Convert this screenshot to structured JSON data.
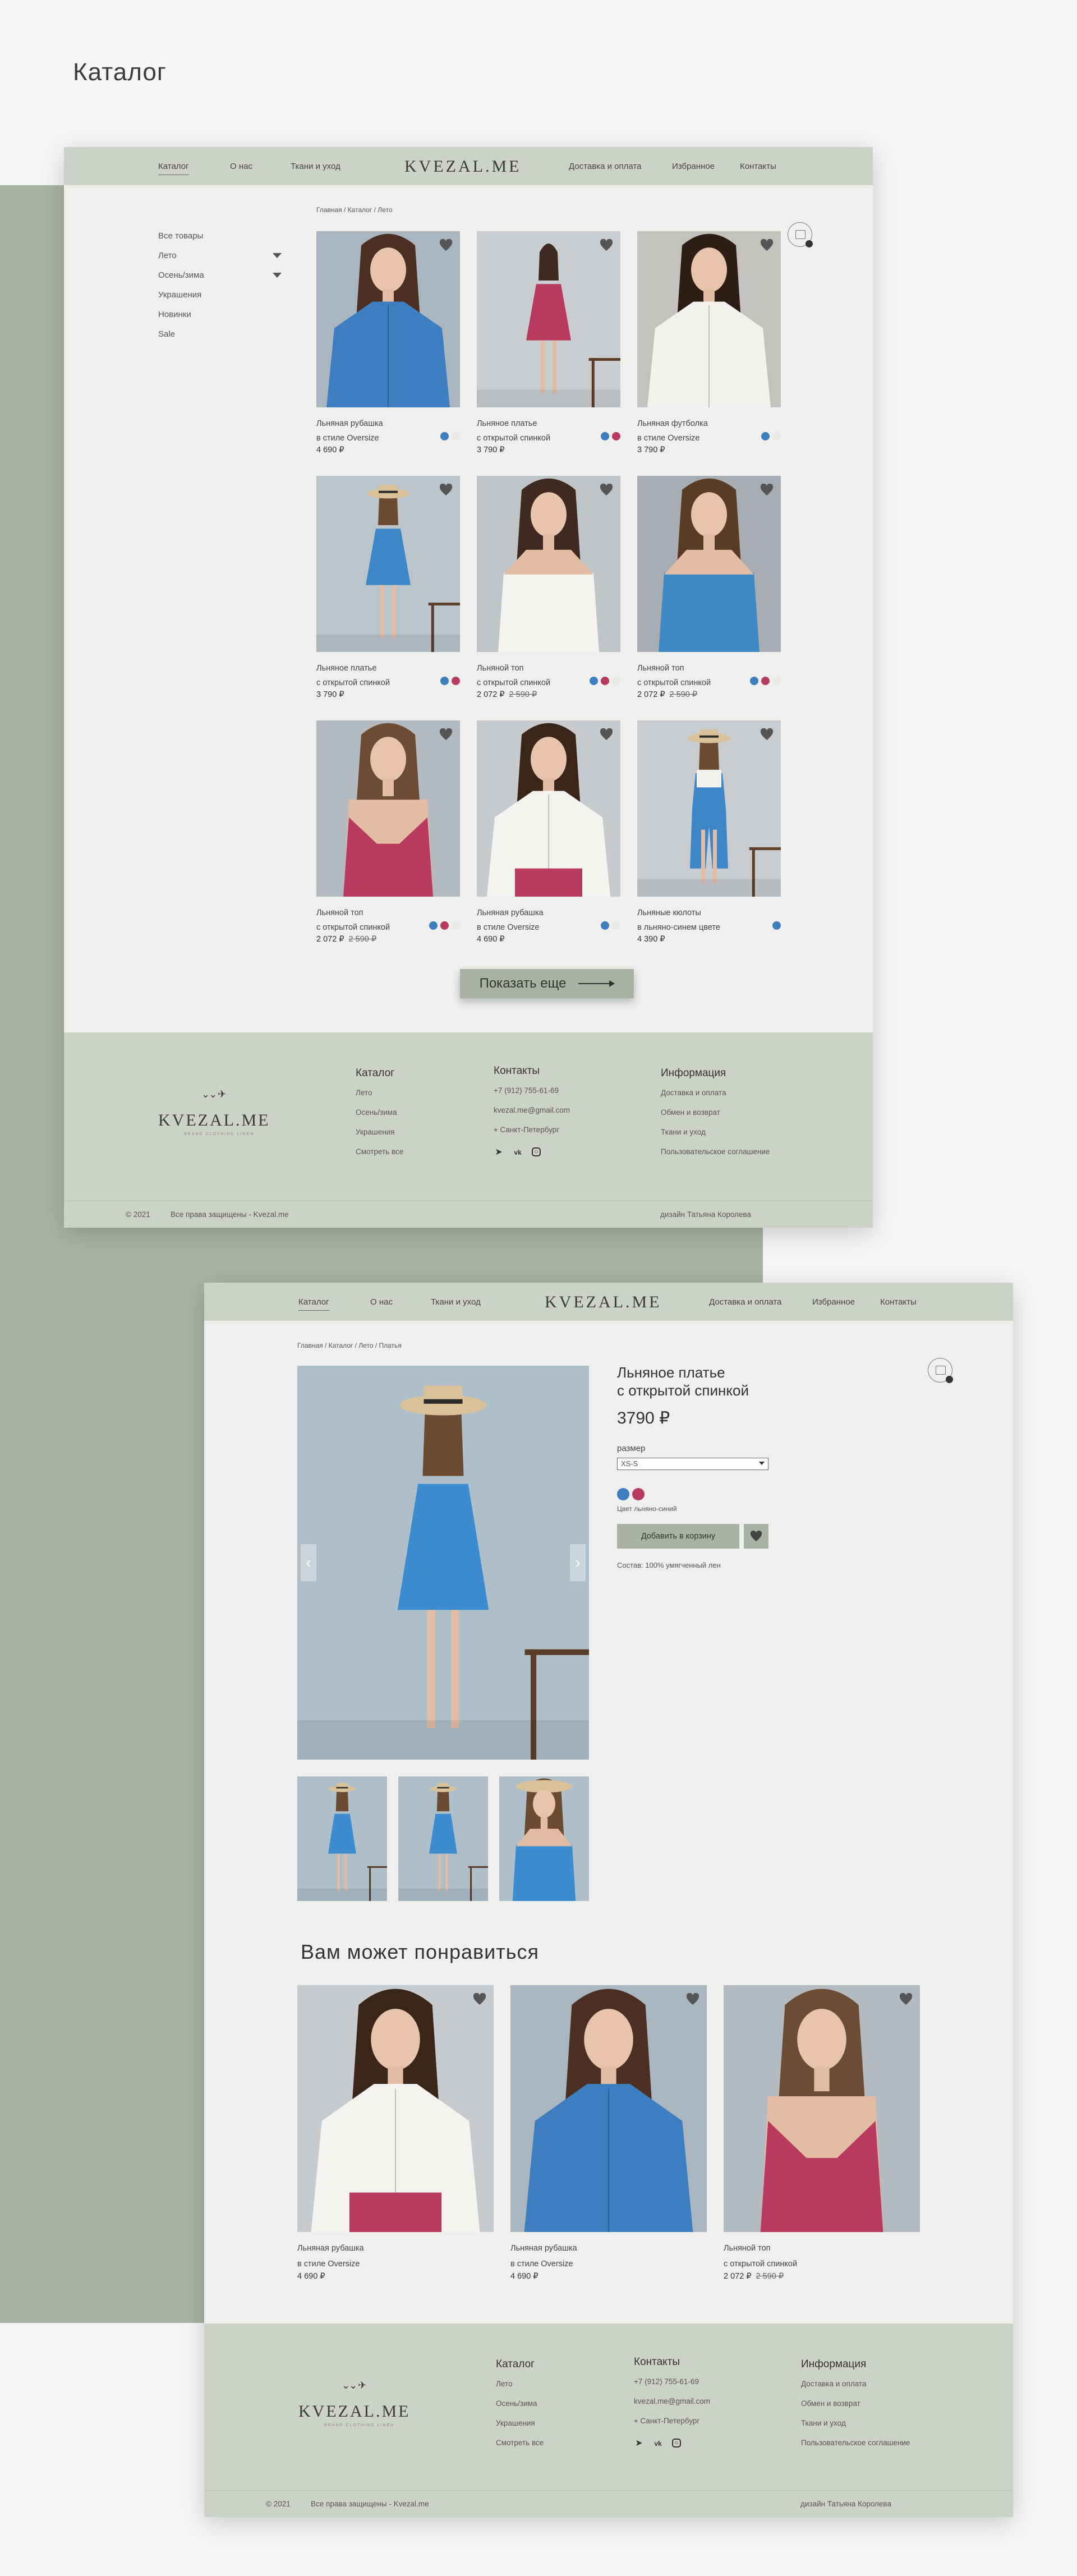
{
  "page_title": "Каталог",
  "brand": {
    "logo": "KVEZAL.ME",
    "tagline": "BRAND CLOTHING LINEN"
  },
  "nav": {
    "left": [
      "Каталог",
      "О нас",
      "Ткани и уход"
    ],
    "right": [
      "Доставка и оплата",
      "Избранное",
      "Контакты"
    ]
  },
  "colors": {
    "accent": "#aab3a3",
    "nav_bg": "#cdd2c9",
    "blue": "#3d7ec0",
    "raspberry": "#b83a5e",
    "white": "#e8e8e4"
  },
  "catalog": {
    "breadcrumb": "Главная / Каталог / Лето",
    "sidebar": [
      {
        "label": "Все товары",
        "chevron": false
      },
      {
        "label": "Лето",
        "chevron": true
      },
      {
        "label": "Осень/зима",
        "chevron": true
      },
      {
        "label": "Украшения",
        "chevron": false
      },
      {
        "label": "Новинки",
        "chevron": false
      },
      {
        "label": "Sale",
        "chevron": false
      }
    ],
    "products": [
      {
        "line1": "Льняная рубашка",
        "line2": "в стиле Oversize",
        "price": "4 690 ₽",
        "old_price": "",
        "swatches": [
          "#3d7ec0",
          "#e8e8e4"
        ],
        "photo": "blue-shirt"
      },
      {
        "line1": "Льняное платье",
        "line2": "с открытой спинкой",
        "price": "3 790 ₽",
        "old_price": "",
        "swatches": [
          "#3d7ec0",
          "#b83a5e"
        ],
        "photo": "pink-dress"
      },
      {
        "line1": "Льняная футболка",
        "line2": "в стиле Oversize",
        "price": "3 790 ₽",
        "old_price": "",
        "swatches": [
          "#3d7ec0",
          "#e8e8e4"
        ],
        "photo": "white-tee"
      },
      {
        "line1": "Льняное платье",
        "line2": "с открытой спинкой",
        "price": "3 790 ₽",
        "old_price": "",
        "swatches": [
          "#3d7ec0",
          "#b83a5e"
        ],
        "photo": "blue-dress"
      },
      {
        "line1": "Льняной топ",
        "line2": "с открытой спинкой",
        "price": "2 072 ₽",
        "old_price": "2 590 ₽",
        "swatches": [
          "#3d7ec0",
          "#b83a5e",
          "#e8e8e4"
        ],
        "photo": "white-top"
      },
      {
        "line1": "Льняной топ",
        "line2": "с открытой спинкой",
        "price": "2 072 ₽",
        "old_price": "2 590 ₽",
        "swatches": [
          "#3d7ec0",
          "#b83a5e",
          "#e8e8e4"
        ],
        "photo": "blue-top"
      },
      {
        "line1": "Льняной топ",
        "line2": "с открытой спинкой",
        "price": "2 072 ₽",
        "old_price": "2 590 ₽",
        "swatches": [
          "#3d7ec0",
          "#b83a5e",
          "#e8e8e4"
        ],
        "photo": "pink-top"
      },
      {
        "line1": "Льняная рубашка",
        "line2": "в стиле Oversize",
        "price": "4 690 ₽",
        "old_price": "",
        "swatches": [
          "#3d7ec0",
          "#e8e8e4"
        ],
        "photo": "white-shirt"
      },
      {
        "line1": "Льняные кюлоты",
        "line2": "в льняно-синем цвете",
        "price": "4 390 ₽",
        "old_price": "",
        "swatches": [
          "#3d7ec0"
        ],
        "photo": "blue-culottes"
      }
    ],
    "more_button": "Показать еще"
  },
  "footer": {
    "catalog_title": "Каталог",
    "catalog_links": [
      "Лето",
      "Осень/зима",
      "Украшения",
      "Смотреть все"
    ],
    "contacts_title": "Контакты",
    "phone": "+7 (912) 755-61-69",
    "email": "kvezal.me@gmail.com",
    "city": "Санкт-Петербург",
    "info_title": "Информация",
    "info_links": [
      "Доставка и оплата",
      "Обмен и возврат",
      "Ткани и уход",
      "Пользовательское соглашение"
    ],
    "year": "© 2021",
    "rights": "Все права защищены - Kvezal.me",
    "design": "дизайн Татьяна Королева"
  },
  "product": {
    "breadcrumb": "Главная / Каталог / Лето / Платья",
    "name_line1": "Льняное платье",
    "name_line2": "с открытой спинкой",
    "price": "3790 ₽",
    "size_label": "размер",
    "size_value": "XS-S",
    "swatches": [
      "#3d7ec0",
      "#b83a5e"
    ],
    "color_text": "Цвет льняно-синий",
    "add_to_cart": "Добавить в корзину",
    "composition": "Состав: 100% умягченный лен"
  },
  "recommend": {
    "title": "Вам может понравиться",
    "items": [
      {
        "line1": "Льняная рубашка",
        "line2": "в стиле Oversize",
        "price": "4 690 ₽",
        "old_price": "",
        "photo": "white-shirt"
      },
      {
        "line1": "Льняная рубашка",
        "line2": "в стиле Oversize",
        "price": "4 690 ₽",
        "old_price": "",
        "photo": "blue-shirt"
      },
      {
        "line1": "Льняной топ",
        "line2": "с открытой спинкой",
        "price": "2 072 ₽",
        "old_price": "2 590 ₽",
        "photo": "pink-top"
      }
    ]
  }
}
